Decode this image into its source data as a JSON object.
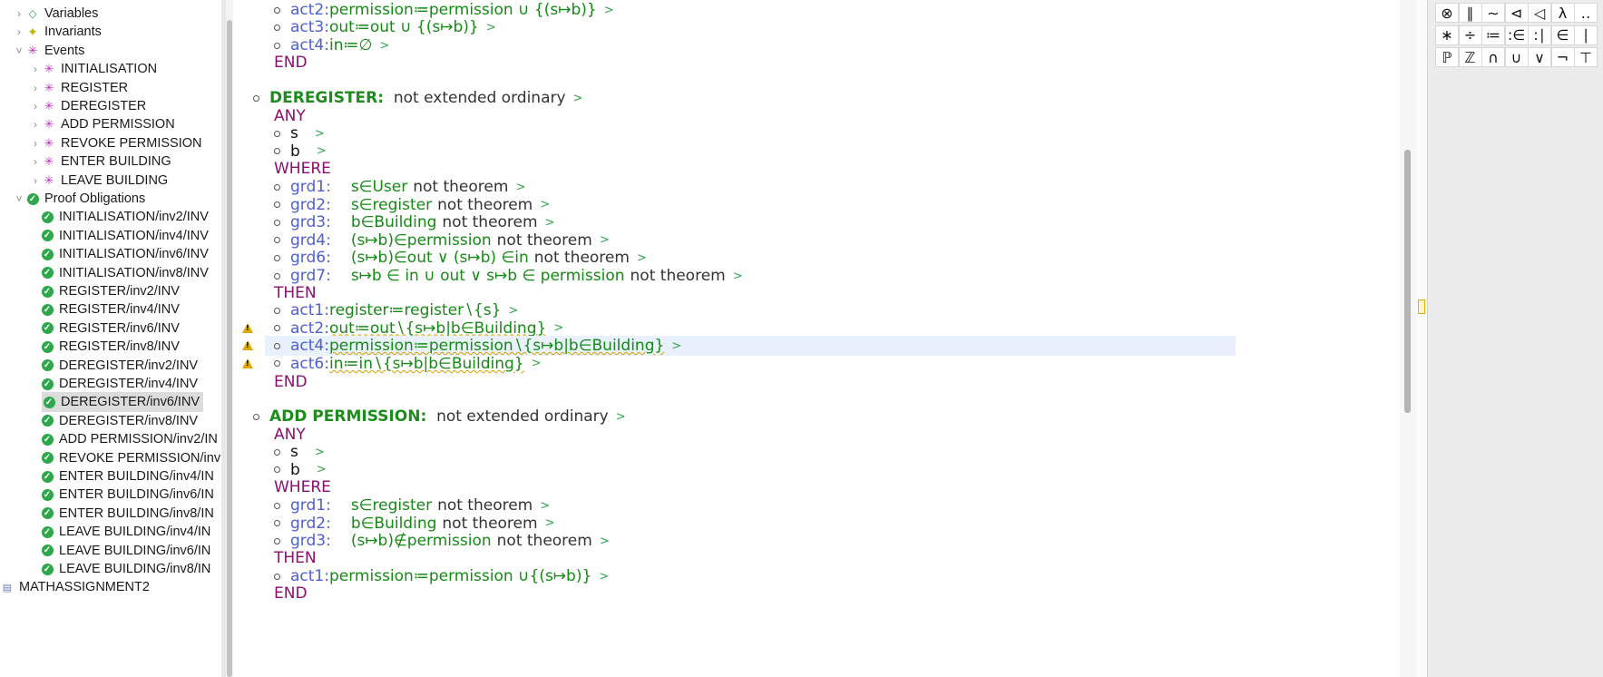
{
  "explorer": {
    "items": [
      {
        "label": "Variables",
        "icon": "variables-icon",
        "twisty": ">"
      },
      {
        "label": "Invariants",
        "icon": "invariants-icon",
        "twisty": ">"
      },
      {
        "label": "Events",
        "icon": "events-icon",
        "twisty": "v"
      },
      {
        "label": "INITIALISATION",
        "icon": "event-icon",
        "twisty": ">"
      },
      {
        "label": "REGISTER",
        "icon": "event-icon",
        "twisty": ">"
      },
      {
        "label": "DEREGISTER",
        "icon": "event-warning-icon",
        "twisty": ">"
      },
      {
        "label": "ADD PERMISSION",
        "icon": "event-icon",
        "twisty": ">"
      },
      {
        "label": "REVOKE PERMISSION",
        "icon": "event-icon",
        "twisty": ">"
      },
      {
        "label": "ENTER BUILDING",
        "icon": "event-icon",
        "twisty": ">"
      },
      {
        "label": "LEAVE BUILDING",
        "icon": "event-icon",
        "twisty": ">"
      },
      {
        "label": "Proof Obligations",
        "icon": "proof-obligations-icon",
        "twisty": "v"
      },
      {
        "label": "INITIALISATION/inv2/INV",
        "icon": "discharged-po-icon"
      },
      {
        "label": "INITIALISATION/inv4/INV",
        "icon": "discharged-po-icon"
      },
      {
        "label": "INITIALISATION/inv6/INV",
        "icon": "discharged-po-icon"
      },
      {
        "label": "INITIALISATION/inv8/INV",
        "icon": "discharged-po-icon"
      },
      {
        "label": "REGISTER/inv2/INV",
        "icon": "discharged-po-icon"
      },
      {
        "label": "REGISTER/inv4/INV",
        "icon": "discharged-po-icon"
      },
      {
        "label": "REGISTER/inv6/INV",
        "icon": "discharged-po-icon"
      },
      {
        "label": "REGISTER/inv8/INV",
        "icon": "discharged-po-icon"
      },
      {
        "label": "DEREGISTER/inv2/INV",
        "icon": "discharged-po-icon"
      },
      {
        "label": "DEREGISTER/inv4/INV",
        "icon": "discharged-po-icon"
      },
      {
        "label": "DEREGISTER/inv6/INV",
        "icon": "discharged-po-icon",
        "selected": true
      },
      {
        "label": "DEREGISTER/inv8/INV",
        "icon": "discharged-po-icon"
      },
      {
        "label": "ADD PERMISSION/inv2/IN",
        "icon": "discharged-po-icon"
      },
      {
        "label": "REVOKE PERMISSION/inv",
        "icon": "discharged-po-icon"
      },
      {
        "label": "ENTER BUILDING/inv4/IN",
        "icon": "discharged-po-icon"
      },
      {
        "label": "ENTER BUILDING/inv6/IN",
        "icon": "discharged-po-icon"
      },
      {
        "label": "ENTER BUILDING/inv8/IN",
        "icon": "discharged-po-icon"
      },
      {
        "label": "LEAVE BUILDING/inv4/IN",
        "icon": "discharged-po-icon"
      },
      {
        "label": "LEAVE BUILDING/inv6/IN",
        "icon": "discharged-po-icon"
      },
      {
        "label": "LEAVE BUILDING/inv8/IN",
        "icon": "discharged-po-icon"
      },
      {
        "label": "MATHASSIGNMENT2",
        "icon": "project-icon"
      }
    ]
  },
  "editor": {
    "top": {
      "act2_label": "act2:",
      "act2_pred": "permission≔permission ∪ {(s↦b)}",
      "act3_label": "act3:",
      "act3_pred": "out≔out ∪ {(s↦b)}",
      "act4_label": "act4:",
      "act4_pred": "in≔∅",
      "end": "END"
    },
    "deregister": {
      "name": "DEREGISTER",
      "colon": ":",
      "extended": "not extended ordinary",
      "any": "ANY",
      "params": [
        "s",
        "b"
      ],
      "where": "WHERE",
      "guards": [
        {
          "label": "grd1:",
          "pred": "s∈User",
          "suffix": "not theorem"
        },
        {
          "label": "grd2:",
          "pred": "s∈register",
          "suffix": "not theorem"
        },
        {
          "label": "grd3:",
          "pred": "b∈Building",
          "suffix": "not theorem"
        },
        {
          "label": "grd4:",
          "pred": "(s↦b)∈permission",
          "suffix": "not theorem"
        },
        {
          "label": "grd6:",
          "pred": "(s↦b)∈out ∨ (s↦b) ∈in",
          "suffix": "not theorem"
        },
        {
          "label": "grd7:",
          "pred": "s↦b ∈ in ∪ out ∨ s↦b ∈ permission",
          "suffix": "not theorem"
        }
      ],
      "then": "THEN",
      "actions": [
        {
          "label": "act1:",
          "pred": "register≔register∖{s}"
        },
        {
          "label": "act2:",
          "pred": "out≔out∖{s↦b|b∈Building}"
        },
        {
          "label": "act4:",
          "pred": "permission≔permission∖{s↦b|b∈Building}"
        },
        {
          "label": "act6:",
          "pred": "in≔in∖{s↦b|b∈Building}"
        }
      ],
      "end": "END"
    },
    "add_permission": {
      "name": "ADD PERMISSION",
      "colon": ":",
      "extended": "not extended ordinary",
      "any": "ANY",
      "params": [
        "s",
        "b"
      ],
      "where": "WHERE",
      "guards": [
        {
          "label": "grd1:",
          "pred": "s∈register",
          "suffix": "not theorem"
        },
        {
          "label": "grd2:",
          "pred": "b∈Building",
          "suffix": "not theorem"
        },
        {
          "label": "grd3:",
          "pred": "(s↦b)∉permission",
          "suffix": "not theorem"
        }
      ],
      "then": "THEN",
      "actions": [
        {
          "label": "act1:",
          "pred": "permission≔permission ∪{(s↦b)}"
        }
      ],
      "end": "END"
    },
    "chevron": ">"
  },
  "palette": {
    "rows": [
      [
        "⊗",
        "∥",
        "∼",
        "⊲",
        "◁",
        "λ",
        "‥"
      ],
      [
        "∗",
        "÷",
        "≔",
        ":∈",
        ":∣",
        "∈",
        "∣"
      ],
      [
        "ℙ",
        "ℤ",
        "∩",
        "∪",
        "∨",
        "¬",
        "⊤"
      ]
    ]
  },
  "colors": {
    "keyword": "#8a0f6e",
    "label": "#4f5fd0",
    "predicate": "#158a15",
    "event_name": "#1c8c1c",
    "po_ok": "#2ea64a",
    "warning": "#e0a800"
  }
}
